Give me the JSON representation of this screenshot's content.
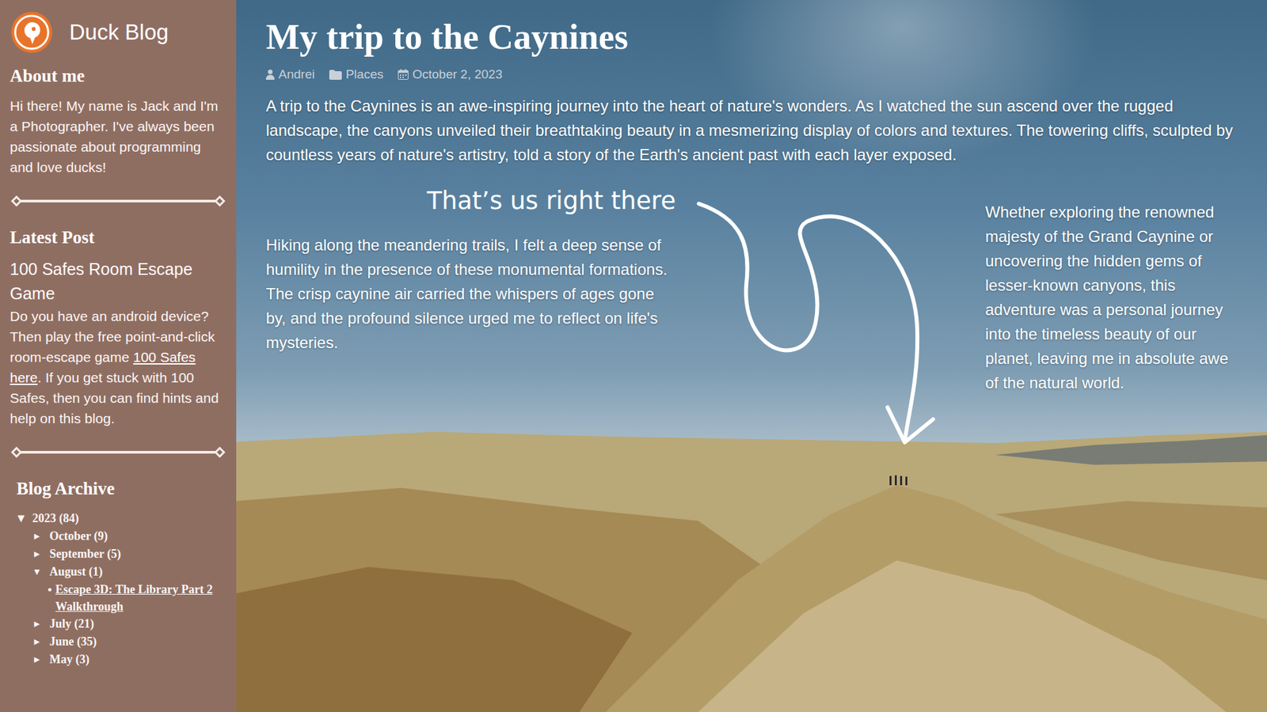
{
  "blog": {
    "title": "Duck Blog"
  },
  "sidebar": {
    "about": {
      "heading": "About me",
      "text": "Hi there! My name is Jack and I'm a Photographer. I've always been passionate about programming and love ducks!"
    },
    "latest": {
      "heading": "Latest Post",
      "title": "100 Safes Room Escape Game",
      "text_before": "Do you have an android device? Then play the free point-and-click room-escape game ",
      "link": "100 Safes here",
      "text_after": ". If you get stuck with 100 Safes, then you can find hints and help on this blog."
    },
    "archive": {
      "heading": "Blog Archive",
      "years": [
        {
          "label": "2023 (84)",
          "toggle": "▼",
          "expanded": true,
          "months": [
            {
              "label": "October (9)",
              "toggle": "►",
              "expanded": false,
              "posts": []
            },
            {
              "label": "September (5)",
              "toggle": "►",
              "expanded": false,
              "posts": []
            },
            {
              "label": "August (1)",
              "toggle": "▼",
              "expanded": true,
              "posts": [
                "Escape 3D: The Library Part 2 Walkthrough"
              ]
            },
            {
              "label": "July (21)",
              "toggle": "►",
              "expanded": false,
              "posts": []
            },
            {
              "label": "June (35)",
              "toggle": "►",
              "expanded": false,
              "posts": []
            },
            {
              "label": "May (3)",
              "toggle": "►",
              "expanded": false,
              "posts": []
            }
          ]
        }
      ]
    }
  },
  "post": {
    "title": "My trip to the Caynines",
    "meta": {
      "author": "Andrei",
      "category": "Places",
      "date": "October 2, 2023"
    },
    "intro": "A trip to the Caynines is an awe-inspiring journey into the heart of nature's wonders. As I watched the sun ascend over the rugged landscape, the canyons unveiled their breathtaking beauty in a mesmerizing display of colors and textures. The towering cliffs, sculpted by countless years of nature's artistry, told a story of the Earth's ancient past with each layer exposed.",
    "annotation": "That’s us right there",
    "left_paragraph": "Hiking along the meandering trails, I felt a deep sense of humility in the presence of these monumental formations. The crisp caynine air carried the whispers of ages gone by, and the profound silence urged me to reflect on life's mysteries.",
    "right_paragraph": "Whether exploring the renowned majesty of the Grand Caynine or uncovering the hidden gems of lesser-known canyons, this adventure was a personal journey into the timeless beauty of our planet, leaving me in absolute awe of the natural world."
  }
}
